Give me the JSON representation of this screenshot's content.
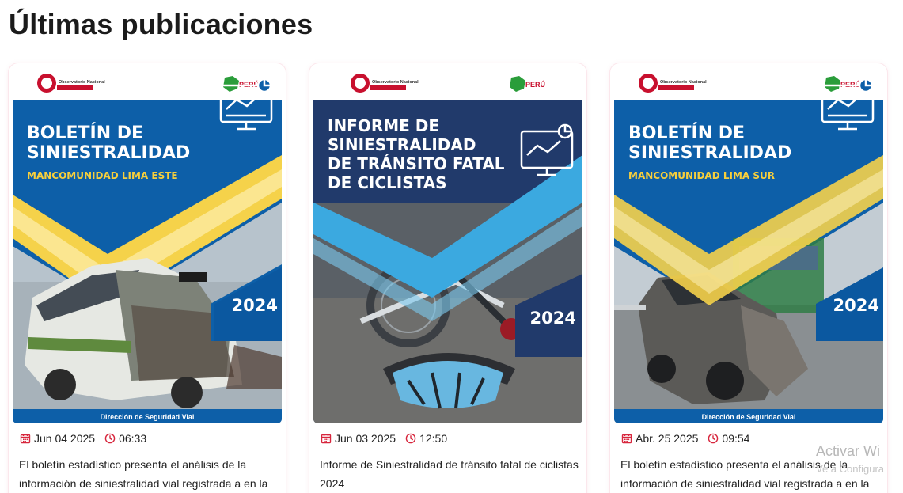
{
  "page": {
    "title": "Últimas publicaciones"
  },
  "cards": [
    {
      "cover": {
        "logo_left": "Observatorio Nacional de Seguridad Vial",
        "logo_right": "PERÚ",
        "title_line1": "BOLETÍN DE",
        "title_line2": "SINIESTRALIDAD",
        "subtitle": "MANCOMUNIDAD LIMA ESTE",
        "year": "2024",
        "footer": "Dirección de Seguridad Vial"
      },
      "date": "Jun 04 2025",
      "time": "06:33",
      "description": "El boletín estadístico presenta el análisis de la información de siniestralidad vial registrada a en la"
    },
    {
      "cover": {
        "logo_left": "Observatorio Nacional de Seguridad Vial",
        "logo_right": "PERÚ",
        "title_line1": "INFORME DE",
        "title_line2": "SINIESTRALIDAD",
        "title_line3": "DE TRÁNSITO FATAL",
        "title_line4": "DE CICLISTAS",
        "year": "2024"
      },
      "date": "Jun 03 2025",
      "time": "12:50",
      "description": "Informe de Siniestralidad de tránsito fatal de ciclistas 2024"
    },
    {
      "cover": {
        "logo_left": "Observatorio Nacional de Seguridad Vial",
        "logo_right": "PERÚ",
        "title_line1": "BOLETÍN DE",
        "title_line2": "SINIESTRALIDAD",
        "subtitle": "MANCOMUNIDAD LIMA SUR",
        "year": "2024",
        "footer": "Dirección de Seguridad Vial"
      },
      "date": "Abr. 25 2025",
      "time": "09:54",
      "description": "El boletín estadístico presenta el análisis de la información de siniestralidad vial registrada a en la"
    }
  ],
  "watermark": {
    "line1": "Activar Wi",
    "line2": "Ve a Configura"
  },
  "icons": {
    "calendar": "calendar-icon",
    "clock": "clock-icon"
  },
  "colors": {
    "accent_red": "#d7263d",
    "cover_blue": "#0d5fa8",
    "cover_navy": "#213a6b",
    "cover_yellow": "#f7cf3c"
  }
}
